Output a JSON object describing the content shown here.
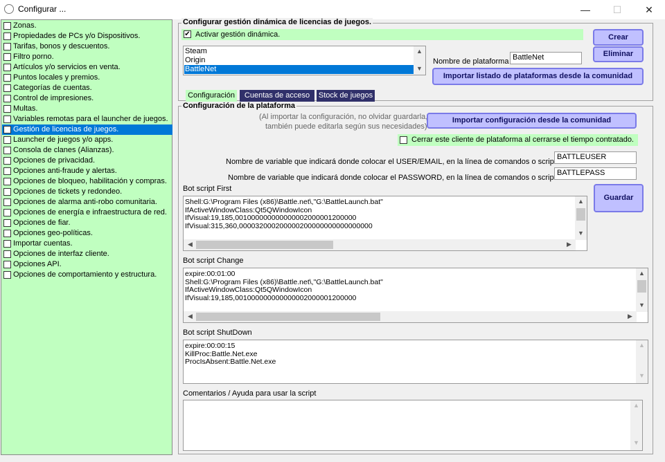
{
  "window": {
    "title": "Configurar ...",
    "minimize": "—",
    "maximize": "☐",
    "close": "✕"
  },
  "sidebar": {
    "items": [
      {
        "label": "Zonas.",
        "checked": false
      },
      {
        "label": "Propiedades de PCs y/o Dispositivos.",
        "checked": false
      },
      {
        "label": "Tarifas, bonos y descuentos.",
        "checked": false
      },
      {
        "label": "Filtro porno.",
        "checked": false
      },
      {
        "label": "Artículos y/o servicios en venta.",
        "checked": false
      },
      {
        "label": "Puntos locales y premios.",
        "checked": false
      },
      {
        "label": "Categorías de cuentas.",
        "checked": false
      },
      {
        "label": "Control de impresiones.",
        "checked": false
      },
      {
        "label": "Multas.",
        "checked": false
      },
      {
        "label": "Variables remotas para el launcher de juegos.",
        "checked": false
      },
      {
        "label": "Gestión de licencias de juegos.",
        "checked": true
      },
      {
        "label": "Launcher de juegos y/o apps.",
        "checked": false
      },
      {
        "label": "Consola de clanes (Alianzas).",
        "checked": false
      },
      {
        "label": "Opciones de privacidad.",
        "checked": false
      },
      {
        "label": "Opciones anti-fraude y alertas.",
        "checked": false
      },
      {
        "label": "Opciones de bloqueo, habilitación y compras.",
        "checked": false
      },
      {
        "label": "Opciones de tickets y redondeo.",
        "checked": false
      },
      {
        "label": "Opciones de alarma anti-robo comunitaria.",
        "checked": false
      },
      {
        "label": "Opciones de energía e infraestructura de red.",
        "checked": false
      },
      {
        "label": "Opciones de fiar.",
        "checked": false
      },
      {
        "label": "Opciones geo-políticas.",
        "checked": false
      },
      {
        "label": "Importar cuentas.",
        "checked": false
      },
      {
        "label": "Opciones de interfaz cliente.",
        "checked": false
      },
      {
        "label": "Opciones API.",
        "checked": false
      },
      {
        "label": "Opciones de comportamiento y estructura.",
        "checked": false
      }
    ],
    "selected_index": 10
  },
  "main": {
    "group_title": "Configurar gestión dinámica de licencias de juegos.",
    "activate_label": "Activar gestión dinámica.",
    "activate_checked": true,
    "platforms": [
      "Steam",
      "Origin",
      "BattleNet"
    ],
    "selected_platform_index": 2,
    "platform_name_label": "Nombre de plataforma",
    "platform_name_value": "BattleNet",
    "create_button": "Crear",
    "delete_button": "Eliminar",
    "import_platforms_button": "Importar listado de plataformas desde la comunidad",
    "tabs": [
      "Configuración",
      "Cuentas de acceso",
      "Stock de juegos"
    ],
    "active_tab_index": 0
  },
  "config": {
    "group_title": "Configuración de la plataforma",
    "note_line1": "(Al importar la configuración, no olvidar guardarla,",
    "note_line2": "también puede editarla según sus necesidades)",
    "import_config_button": "Importar configuración desde la comunidad",
    "close_client_label": "Cerrar este cliente de plataforma al cerrarse el tiempo contratado.",
    "close_client_checked": false,
    "user_var_label": "Nombre de variable que indicará donde colocar el USER/EMAIL, en la línea de comandos o script:",
    "user_var_value": "BATTLEUSER",
    "pass_var_label": "Nombre de variable que indicará donde colocar el PASSWORD, en la línea de comandos o script:",
    "pass_var_value": "BATTLEPASS",
    "save_button": "Guardar",
    "bot_first_label": "Bot script First",
    "bot_first_lines": [
      "Shell:G:\\Program Files (x86)\\Battle.net\\,\"G:\\BattleLaunch.bat\"",
      "IfActiveWindowClass:Qt5QWindowIcon",
      "IfVisual:19,185,001000000000000002000001200000",
      "IfVisual:315,360,000032000200000200000000000000000"
    ],
    "bot_change_label": "Bot script Change",
    "bot_change_lines": [
      "expire:00:01:00",
      "Shell:G:\\Program Files (x86)\\Battle.net\\,\"G:\\BattleLaunch.bat\"",
      "IfActiveWindowClass:Qt5QWindowIcon",
      "IfVisual:19,185,001000000000000002000001200000"
    ],
    "bot_shutdown_label": "Bot script ShutDown",
    "bot_shutdown_lines": [
      "expire:00:00:15",
      "KillProc:Battle.Net.exe",
      "ProcIsAbsent:Battle.Net.exe"
    ],
    "comments_label": "Comentarios / Ayuda para usar la script",
    "comments_value": ""
  },
  "icons": {
    "check": "✔",
    "scroll_up": "▲",
    "scroll_down": "▼",
    "scroll_left": "◀",
    "scroll_right": "▶",
    "app": "gear-icon"
  },
  "colors": {
    "green": "#c0ffc0",
    "button_bg": "#c0c0ff",
    "button_border": "#7a7ae8",
    "selection": "#0078d7",
    "tab_dark": "#30306a"
  }
}
